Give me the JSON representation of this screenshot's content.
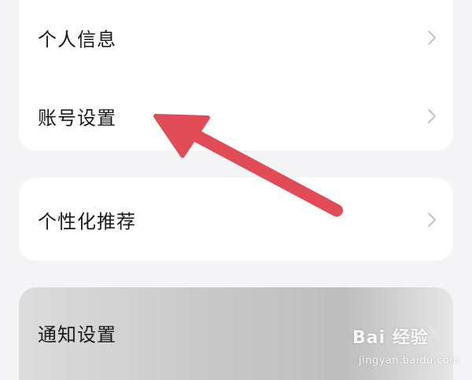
{
  "settings": {
    "groups": [
      {
        "items": [
          {
            "label": "个人信息"
          },
          {
            "label": "账号设置"
          }
        ]
      },
      {
        "items": [
          {
            "label": "个性化推荐"
          }
        ]
      },
      {
        "items": [
          {
            "label": "通知设置"
          }
        ]
      }
    ]
  },
  "annotation": {
    "arrow_color": "#e04b55",
    "points_to": "账号设置"
  },
  "watermark": {
    "brand": "Bai 经验",
    "url": "jingyan.baidu.com"
  }
}
